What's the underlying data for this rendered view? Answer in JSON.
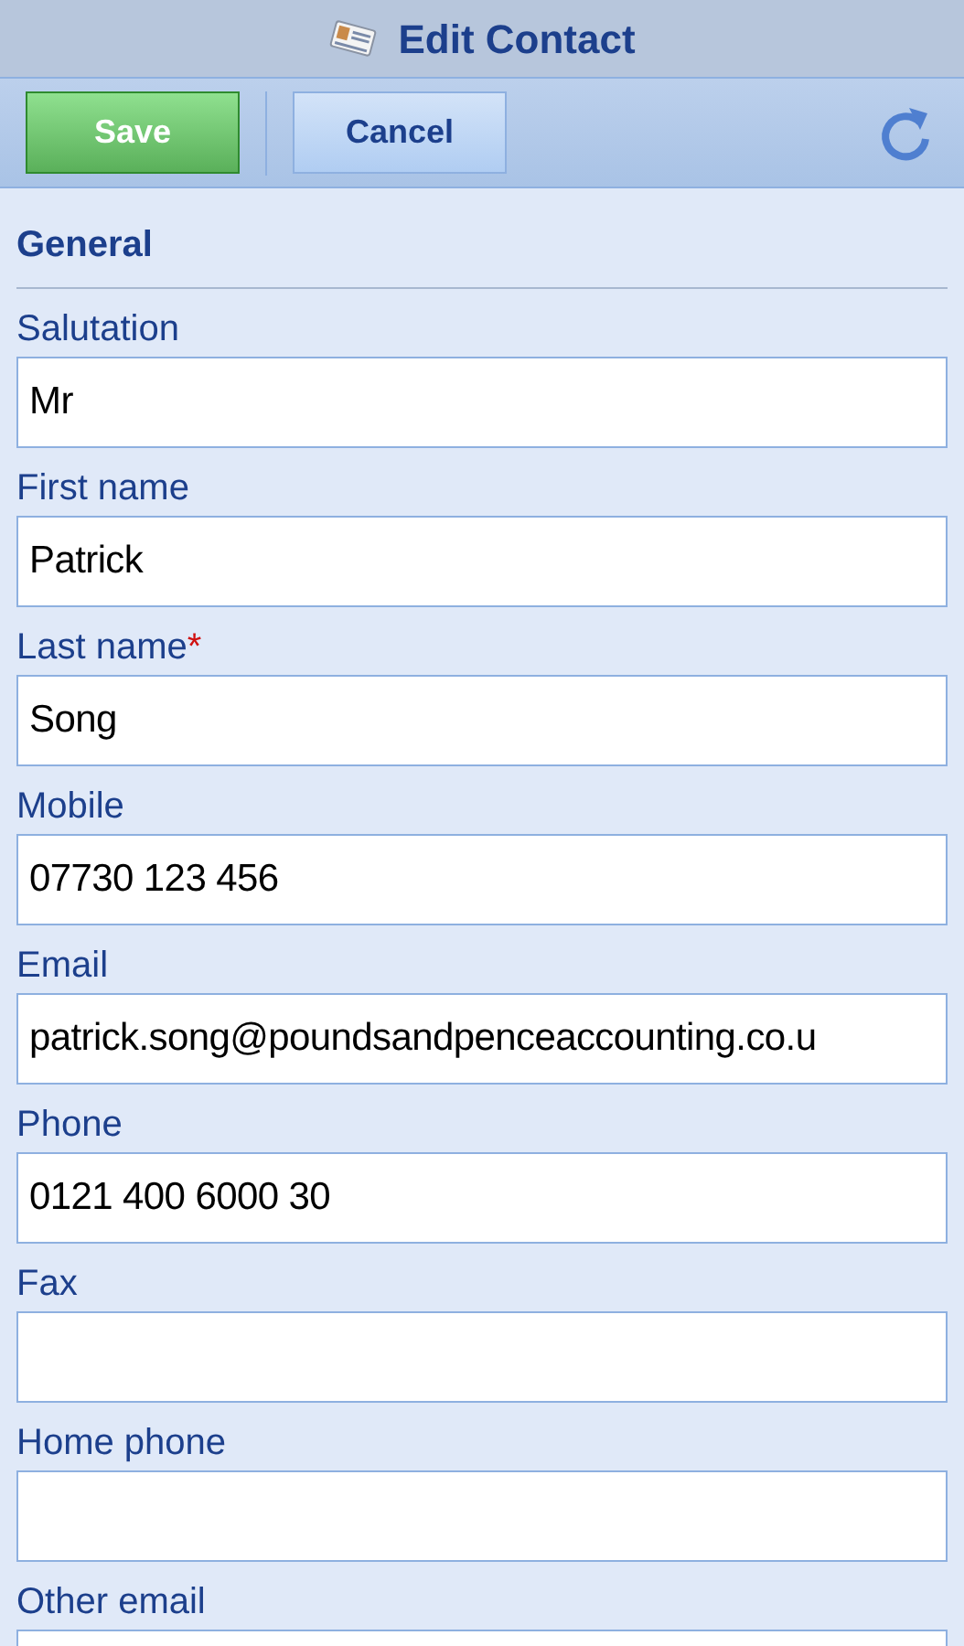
{
  "window": {
    "title": "Edit Contact"
  },
  "toolbar": {
    "save": "Save",
    "cancel": "Cancel"
  },
  "section": {
    "title": "General"
  },
  "fields": [
    {
      "label": "Salutation",
      "value": "Mr"
    },
    {
      "label": "First name",
      "value": "Patrick"
    },
    {
      "label": "Last name",
      "required_mark": "*",
      "value": "Song"
    },
    {
      "label": "Mobile",
      "value": "07730 123 456"
    },
    {
      "label": "Email",
      "value": "patrick.song@poundsandpenceaccounting.co.u"
    },
    {
      "label": "Phone",
      "value": "0121 400 6000 30"
    },
    {
      "label": "Fax"
    },
    {
      "label": "Home phone"
    },
    {
      "label": "Other email"
    }
  ]
}
